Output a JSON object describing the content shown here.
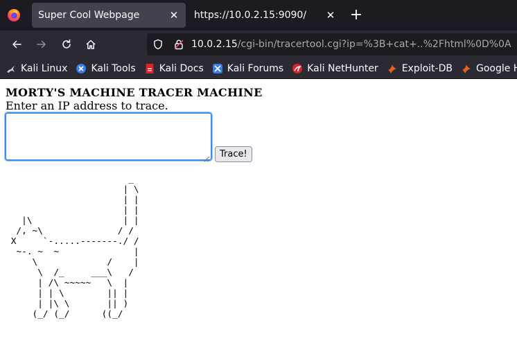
{
  "tabs": [
    {
      "title": "Super Cool Webpage",
      "active": true
    },
    {
      "title": "https://10.0.2.15:9090/",
      "active": false
    }
  ],
  "icons": {
    "browser_logo": "firefox-icon",
    "tab_close": "close-icon",
    "new_tab": "plus-icon",
    "back": "back-arrow-icon",
    "forward": "forward-arrow-icon",
    "reload": "reload-icon",
    "home": "home-icon",
    "tracking": "shield-icon",
    "security": "lock-icon"
  },
  "tab_close_glyph": "✕",
  "new_tab_glyph": "+",
  "address_bar": {
    "host": "10.0.2.15",
    "path": "/cgi-bin/tracertool.cgi?ip=%3B+cat+..%2Fhtml%0D%0A"
  },
  "bookmarks": [
    {
      "label": "Kali Linux",
      "icon": "kali-dragon-icon",
      "color": "#c8c8d0"
    },
    {
      "label": "Kali Tools",
      "icon": "kali-tools-icon",
      "color": "#3b7bea"
    },
    {
      "label": "Kali Docs",
      "icon": "kali-docs-icon",
      "color": "#d8232a"
    },
    {
      "label": "Kali Forums",
      "icon": "kali-forums-icon",
      "color": "#3b7bea"
    },
    {
      "label": "Kali NetHunter",
      "icon": "nethunter-icon",
      "color": "#d8232a"
    },
    {
      "label": "Exploit-DB",
      "icon": "exploit-db-icon",
      "color": "#e8601c"
    },
    {
      "label": "Google Hacking",
      "icon": "ghdb-icon",
      "color": "#e8601c"
    }
  ],
  "page": {
    "heading": "MORTY'S MACHINE TRACER MACHINE",
    "instruction": "Enter an IP address to trace.",
    "ip_input_value": "",
    "trace_button": "Trace!",
    "ascii_art": "                       _\n                      | \\\n                      | |\n                      | |\n   |\\                 | |\n  /, ~\\              / /\n X     `-.....-------./ /\n  ~-. ~  ~              |\n     \\             /    |\n      \\  /_     ___\\   /\n      | /\\ ~~~~~   \\  |\n      | | \\        || |\n      | |\\ \\       || )\n     (_/ (_/      ((_/"
  },
  "colors": {
    "tabstrip_bg": "#1c1b22",
    "toolbar_bg": "#2b2a33",
    "active_tab_bg": "#42414d",
    "focus_ring": "#3b8ef0"
  }
}
